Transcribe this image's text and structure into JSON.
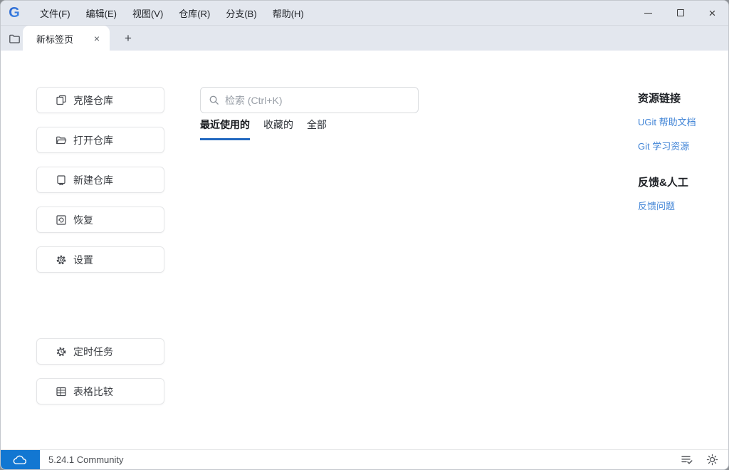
{
  "colors": {
    "titlebar_bg": "#e3e7ee",
    "accent_underline": "#2268c0",
    "link_blue": "#3f83d6",
    "status_blue": "#1277d2"
  },
  "titlebar": {
    "logo": "G",
    "menu": [
      "文件(F)",
      "编辑(E)",
      "视图(V)",
      "仓库(R)",
      "分支(B)",
      "帮助(H)"
    ],
    "controls": {
      "minimize": "",
      "maximize": "",
      "close": "×"
    }
  },
  "tabbar": {
    "tab_label": "新标签页",
    "close": "×",
    "add": "+"
  },
  "sidebar": {
    "buttons": [
      {
        "label": "克隆仓库",
        "icon": "clone-repo-icon"
      },
      {
        "label": "打开仓库",
        "icon": "open-repo-icon"
      },
      {
        "label": "新建仓库",
        "icon": "new-repo-icon"
      },
      {
        "label": "恢复",
        "icon": "restore-icon"
      },
      {
        "label": "设置",
        "icon": "settings-gear-icon"
      }
    ],
    "tools": [
      {
        "label": "定时任务",
        "icon": "scheduled-task-icon"
      },
      {
        "label": "表格比较",
        "icon": "table-compare-icon"
      }
    ]
  },
  "main": {
    "search": {
      "placeholder": "检索 (Ctrl+K)"
    },
    "tabs": [
      {
        "label": "最近使用的",
        "active": true
      },
      {
        "label": "收藏的",
        "active": false
      },
      {
        "label": "全部",
        "active": false
      }
    ]
  },
  "rightpanel": {
    "resources": {
      "title": "资源链接",
      "links": [
        "UGit 帮助文档",
        "Git 学习资源"
      ]
    },
    "feedback": {
      "title": "反馈&人工",
      "links": [
        "反馈问题"
      ]
    }
  },
  "statusbar": {
    "version": "5.24.1 Community",
    "icons": [
      "cloud-sync-icon",
      "task-list-check-icon",
      "theme-brightness-icon"
    ]
  }
}
